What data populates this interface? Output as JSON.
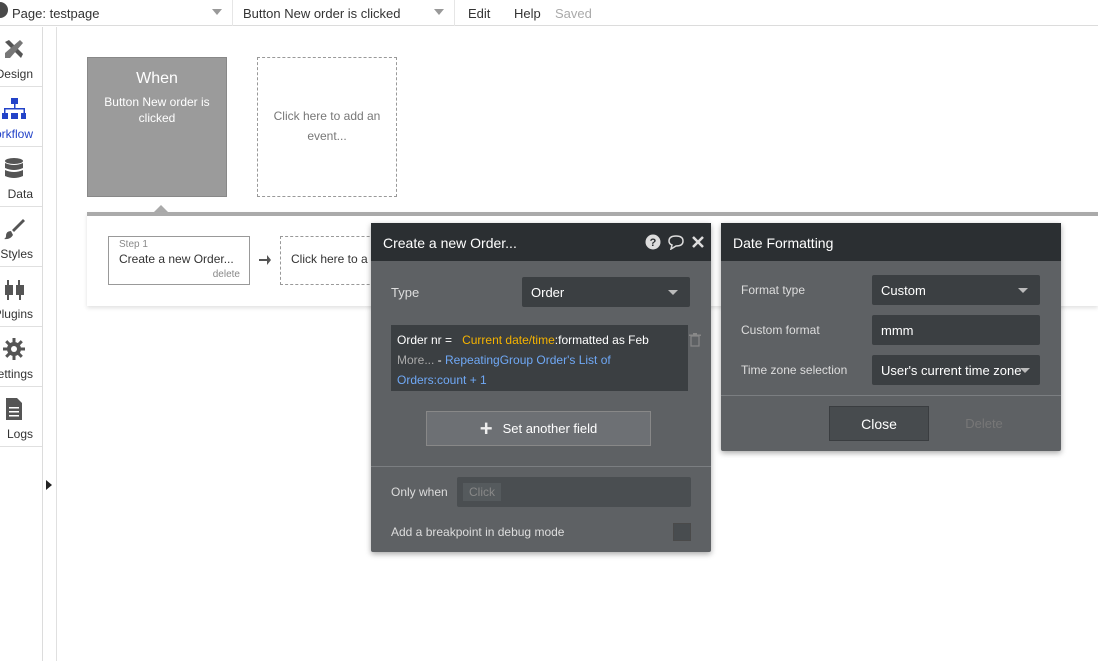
{
  "topbar": {
    "page_selector": "Page: testpage",
    "event_selector": "Button New order is clicked",
    "menu_edit": "Edit",
    "menu_help": "Help",
    "status": "Saved"
  },
  "sidebar": {
    "items": [
      {
        "label": "Design",
        "icon": "design-icon"
      },
      {
        "label": "Workflow",
        "icon": "workflow-icon"
      },
      {
        "label": "Data",
        "icon": "data-icon"
      },
      {
        "label": "Styles",
        "icon": "styles-icon"
      },
      {
        "label": "Plugins",
        "icon": "plugins-icon"
      },
      {
        "label": "Settings",
        "icon": "settings-icon"
      },
      {
        "label": "Logs",
        "icon": "logs-icon"
      }
    ],
    "active": "Workflow"
  },
  "events": {
    "when_title": "When",
    "when_desc": "Button New order is clicked",
    "add_event": "Click here to add an event..."
  },
  "steps": {
    "step_number": "Step 1",
    "step_name": "Create a new Order...",
    "delete_label": "delete",
    "add_action": "Click here to a"
  },
  "create_panel": {
    "title": "Create a new Order...",
    "type_label": "Type",
    "type_value": "Order",
    "expression": {
      "field": "Order nr",
      "equals": "=",
      "dynamic": "Current date/time",
      "operator": ":formatted as Feb",
      "more": "More...",
      "dash": " - ",
      "ref": "RepeatingGroup Order's List of Orders:count + 1"
    },
    "set_field_label": "Set another field",
    "only_when_label": "Only when",
    "only_when_placeholder": "Click",
    "breakpoint_label": "Add a breakpoint in debug mode"
  },
  "format_panel": {
    "title": "Date Formatting",
    "format_type_label": "Format type",
    "format_type_value": "Custom",
    "custom_format_label": "Custom format",
    "custom_format_value": "mmm",
    "timezone_label": "Time zone selection",
    "timezone_value": "User's current time zone",
    "close_label": "Close",
    "delete_label": "Delete"
  },
  "colors": {
    "panel_bg": "#5e6164",
    "panel_header": "#2b2f32",
    "dynamic_text": "#f5b300",
    "ref_text": "#6fa8f5",
    "active_nav": "#2343c8"
  }
}
